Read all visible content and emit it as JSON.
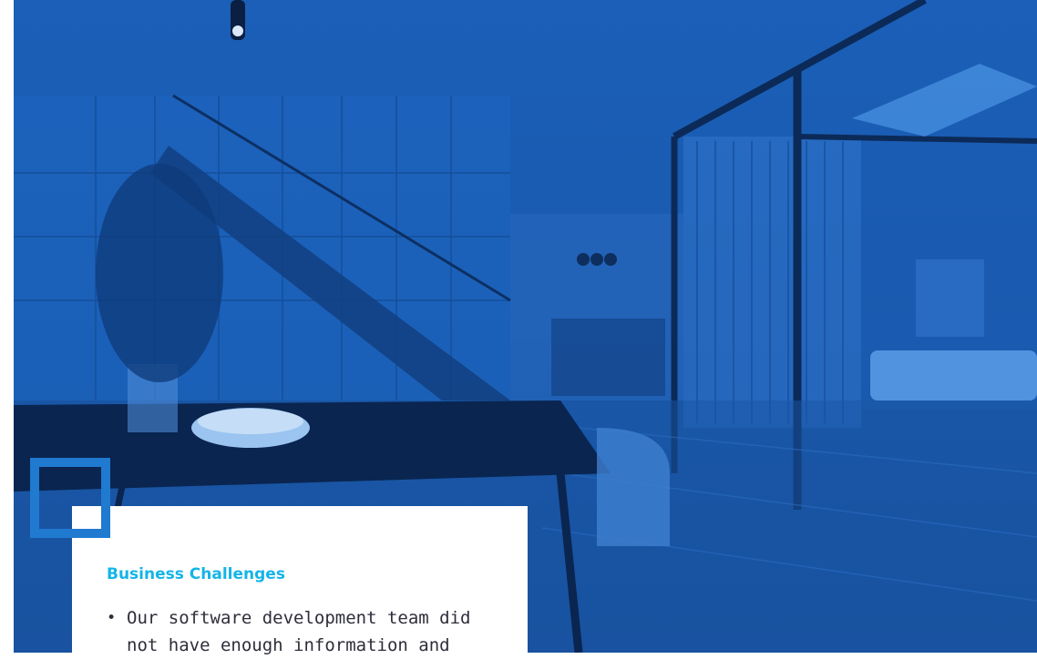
{
  "hero": {
    "image": "interior-photo-blue-overlay",
    "overlay_color": "#1b5fb8"
  },
  "card": {
    "title": "Business Challenges",
    "title_color": "#14b4e8",
    "bullets": [
      "Our software development team did",
      "not have enough information and"
    ]
  },
  "decoration": {
    "square_color": "#1f7ad0"
  }
}
